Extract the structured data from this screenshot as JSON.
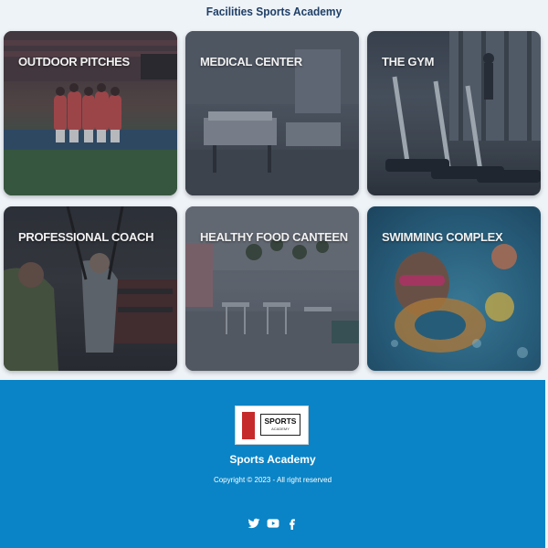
{
  "section": {
    "title": "Facilities Sports Academy"
  },
  "facilities": [
    {
      "label": "OUTDOOR PITCHES"
    },
    {
      "label": "MEDICAL CENTER"
    },
    {
      "label": "THE GYM"
    },
    {
      "label": "PROFESSIONAL COACH"
    },
    {
      "label": "HEALTHY FOOD CANTEEN"
    },
    {
      "label": "SWIMMING COMPLEX"
    }
  ],
  "footer": {
    "logo_word": "SPORTS",
    "logo_sub": "ACADEMY",
    "brand_name": "Sports Academy",
    "copyright": "Copyright © 2023 - All right reserved",
    "social_icons": [
      "twitter-icon",
      "youtube-icon",
      "facebook-icon"
    ]
  },
  "colors": {
    "footer_bg": "#0a84c6",
    "page_bg": "#eef3f8",
    "title": "#1f3f66"
  }
}
